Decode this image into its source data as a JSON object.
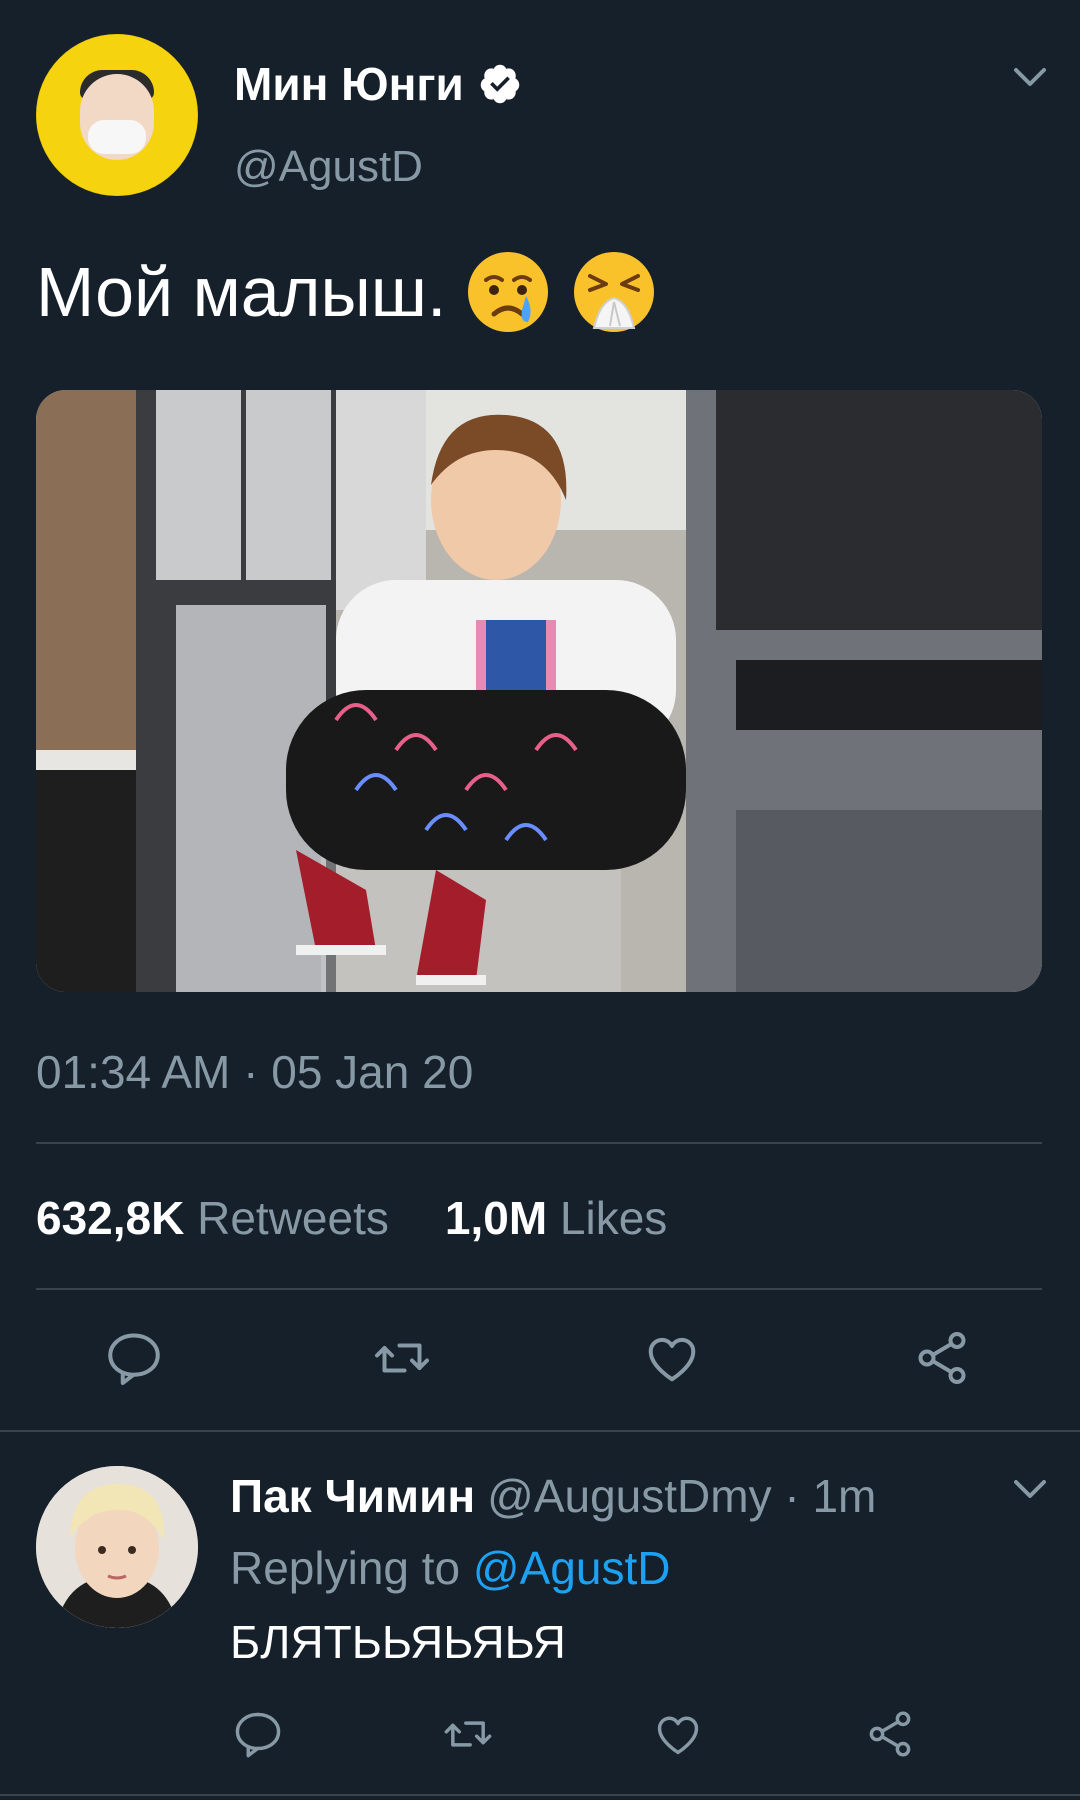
{
  "tweet": {
    "display_name": "Мин Юнги",
    "handle": "@AgustD",
    "text": "Мой малыш.",
    "emojis": [
      "crying-face-emoji",
      "sneezing-face-emoji"
    ],
    "timestamp": "01:34 AM · 05 Jan 20",
    "retweets_count": "632,8K",
    "retweets_label": "Retweets",
    "likes_count": "1,0M",
    "likes_label": "Likes",
    "photo": "photo of a person sitting cross-legged on a folding chair"
  },
  "reply": {
    "display_name": "Пак Чимин",
    "handle_time": "@AugustDmy · 1m",
    "replying_prefix": "Replying to",
    "replying_handle": "@AgustD",
    "text": "БЛЯТЬЬЯЬЯЬЯ"
  },
  "icons": {
    "verified": "verified-badge-icon",
    "chevron": "chevron-down-icon",
    "reply": "reply-icon",
    "retweet": "retweet-icon",
    "like": "heart-icon",
    "share": "share-icon"
  },
  "colors": {
    "background": "#15202b",
    "muted_text": "#8899a6",
    "link": "#1da1f2",
    "divider": "#38444d"
  }
}
